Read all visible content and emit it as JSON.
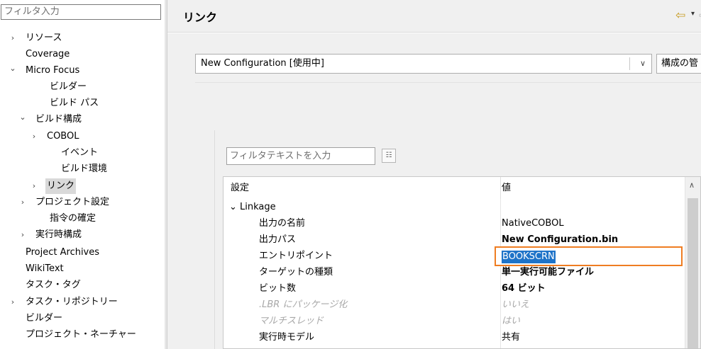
{
  "filter": {
    "placeholder": "フィルタ入力"
  },
  "tree": [
    {
      "label": "リソース",
      "expander": "›",
      "level": 0,
      "expanded": false
    },
    {
      "label": "Coverage",
      "expander": "",
      "level": 0
    },
    {
      "label": "Micro Focus",
      "expander": "⌄",
      "level": 0,
      "expanded": true
    },
    {
      "label": "ビルダー",
      "expander": "",
      "level": 1
    },
    {
      "label": "ビルド パス",
      "expander": "",
      "level": 1
    },
    {
      "label": "ビルド構成",
      "expander": "⌄",
      "level": 1,
      "expanded": true
    },
    {
      "label": "COBOL",
      "expander": "›",
      "level": 2
    },
    {
      "label": "イベント",
      "expander": "",
      "level": 2
    },
    {
      "label": "ビルド環境",
      "expander": "",
      "level": 2
    },
    {
      "label": "リンク",
      "expander": "›",
      "level": 2,
      "selected": true
    },
    {
      "label": "プロジェクト設定",
      "expander": "›",
      "level": 1
    },
    {
      "label": "指令の確定",
      "expander": "",
      "level": 1
    },
    {
      "label": "実行時構成",
      "expander": "›",
      "level": 1
    },
    {
      "label": "Project Archives",
      "expander": "",
      "level": 0
    },
    {
      "label": "WikiText",
      "expander": "",
      "level": 0
    },
    {
      "label": "タスク・タグ",
      "expander": "",
      "level": 0
    },
    {
      "label": "タスク・リポジトリー",
      "expander": "›",
      "level": 0
    },
    {
      "label": "ビルダー",
      "expander": "",
      "level": 0
    },
    {
      "label": "プロジェクト・ネーチャー",
      "expander": "",
      "level": 0
    }
  ],
  "header": {
    "title": "リンク",
    "back_icon": "⇦",
    "menu_icon": "▾",
    "forward_icon": "⇨"
  },
  "config": {
    "selected": "New Configuration  [使用中]",
    "dropdown_icon": "∨",
    "manage_label": "構成の管"
  },
  "settings": {
    "filter_placeholder": "フィルタテキストを入力",
    "filter_icon": "☷"
  },
  "table": {
    "headers": {
      "setting": "設定",
      "value": "値"
    },
    "rows": [
      {
        "name": "Linkage",
        "value": "",
        "group": true
      },
      {
        "name": "出力の名前",
        "value": "NativeCOBOL"
      },
      {
        "name": "出力パス",
        "value": "New Configuration.bin",
        "bold": true
      },
      {
        "name": "エントリポイント",
        "value": "BOOKSCRN",
        "editing": true
      },
      {
        "name": "ターゲットの種類",
        "value": "単一実行可能ファイル",
        "bold": true
      },
      {
        "name": "ビット数",
        "value": "64 ビット",
        "bold": true
      },
      {
        "name": ".LBR にパッケージ化",
        "value": "いいえ",
        "disabled": true
      },
      {
        "name": "マルチスレッド",
        "value": "はい",
        "disabled": true
      },
      {
        "name": "実行時モデル",
        "value": "共有"
      }
    ],
    "scroll_up_icon": "∧"
  },
  "colors": {
    "highlight_border": "#ef7d22",
    "selection": "#1e73c8",
    "nav_back": "#c79a1f"
  }
}
